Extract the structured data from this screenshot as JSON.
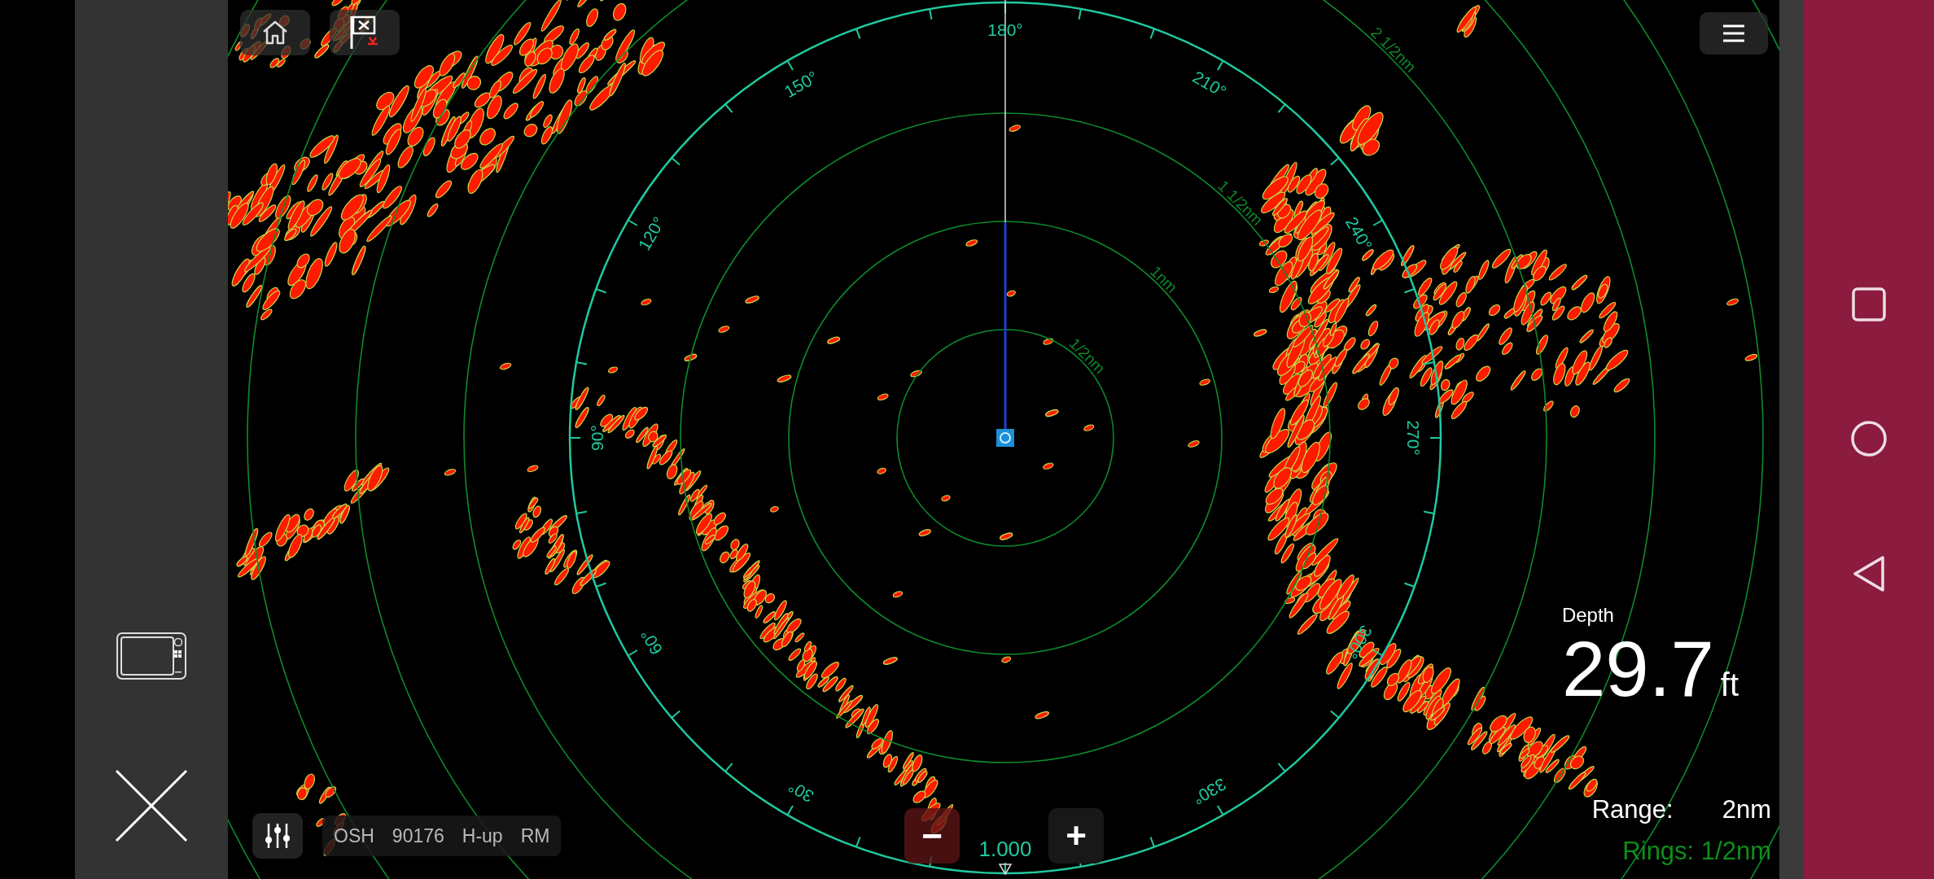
{
  "radar": {
    "bearing_labels": [
      "30°",
      "60°",
      "90°",
      "120°",
      "150°",
      "180°",
      "210°",
      "240°",
      "270°",
      "300°",
      "330°"
    ],
    "ring_labels": [
      "1/2nm",
      "1nm",
      "1 1/2nm",
      "2 1/2nm"
    ],
    "heading_readout": "1.000"
  },
  "status_bar": {
    "items": [
      "OSH",
      "90176",
      "H-up",
      "RM"
    ]
  },
  "zoom": {
    "minus": "−",
    "plus": "+"
  },
  "depth": {
    "label": "Depth",
    "value": "29.7",
    "unit": "ft"
  },
  "range": {
    "label": "Range:",
    "value": "2nm",
    "rings": "Rings: 1/2nm"
  }
}
